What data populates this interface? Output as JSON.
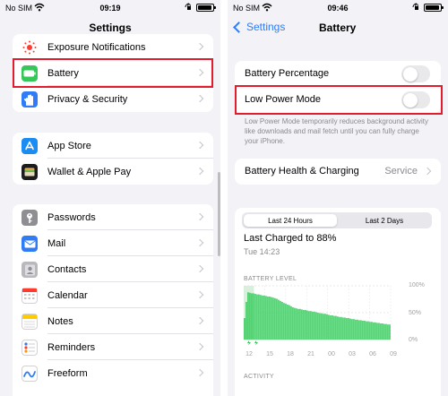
{
  "left": {
    "status": {
      "carrier": "No SIM",
      "time": "09:19"
    },
    "title": "Settings",
    "group1": [
      {
        "label": "Exposure Notifications",
        "icon": "exposure-icon",
        "color": "#ffffff"
      },
      {
        "label": "Battery",
        "icon": "battery-icon",
        "color": "#34c759"
      },
      {
        "label": "Privacy & Security",
        "icon": "hand-icon",
        "color": "#2f7cf6"
      }
    ],
    "group2": [
      {
        "label": "App Store",
        "icon": "app-store-icon",
        "color": "#1a8cf4"
      },
      {
        "label": "Wallet & Apple Pay",
        "icon": "wallet-icon",
        "color": "#1c1c1e"
      }
    ],
    "group3": [
      {
        "label": "Passwords",
        "icon": "key-icon",
        "color": "#8e8e93"
      },
      {
        "label": "Mail",
        "icon": "mail-icon",
        "color": "#2f7cf6"
      },
      {
        "label": "Contacts",
        "icon": "contacts-icon",
        "color": "#b8b8bd"
      },
      {
        "label": "Calendar",
        "icon": "calendar-icon",
        "color": "#ffffff"
      },
      {
        "label": "Notes",
        "icon": "notes-icon",
        "color": "#ffffff"
      },
      {
        "label": "Reminders",
        "icon": "reminders-icon",
        "color": "#ffffff"
      },
      {
        "label": "Freeform",
        "icon": "freeform-icon",
        "color": "#ffffff"
      }
    ]
  },
  "right": {
    "status": {
      "carrier": "No SIM",
      "time": "09:46"
    },
    "back_label": "Settings",
    "title": "Battery",
    "battery_percentage": {
      "label": "Battery Percentage",
      "on": false
    },
    "low_power": {
      "label": "Low Power Mode",
      "on": false
    },
    "low_power_note": "Low Power Mode temporarily reduces background activity like downloads and mail fetch until you can fully charge your iPhone.",
    "health": {
      "label": "Battery Health & Charging",
      "value": "Service"
    },
    "segments": {
      "opt1": "Last 24 Hours",
      "opt2": "Last 2 Days",
      "selected": "Last 24 Hours"
    },
    "last_charged": "Last Charged to 88%",
    "last_charged_time": "Tue 14:23",
    "battery_level_title": "BATTERY LEVEL",
    "activity_title": "ACTIVITY",
    "chart_data": {
      "type": "bar",
      "title": "BATTERY LEVEL",
      "y_ticks": [
        "100%",
        "50%",
        "0%"
      ],
      "x_ticks": [
        "12",
        "15",
        "18",
        "21",
        "00",
        "03",
        "06",
        "09"
      ],
      "ylim": [
        0,
        100
      ],
      "charging_hours": [
        "12",
        "13"
      ],
      "values": [
        40,
        70,
        88,
        87,
        86,
        86,
        85,
        84,
        84,
        83,
        82,
        82,
        81,
        80,
        80,
        79,
        78,
        77,
        76,
        74,
        72,
        70,
        68,
        67,
        65,
        64,
        62,
        60,
        59,
        58,
        57,
        57,
        56,
        55,
        55,
        54,
        53,
        53,
        52,
        52,
        51,
        50,
        49,
        49,
        48,
        48,
        47,
        46,
        45,
        45,
        44,
        44,
        43,
        42,
        42,
        41,
        41,
        40,
        40,
        39,
        38,
        38,
        37,
        37,
        36,
        36,
        35,
        35,
        34,
        34,
        33,
        33,
        32,
        32,
        31,
        31,
        30,
        30,
        29,
        29,
        28,
        28
      ],
      "colors": {
        "bar": "#34c759",
        "charging_bg": "#d8efdc",
        "grid": "#e4e4e8"
      }
    }
  }
}
